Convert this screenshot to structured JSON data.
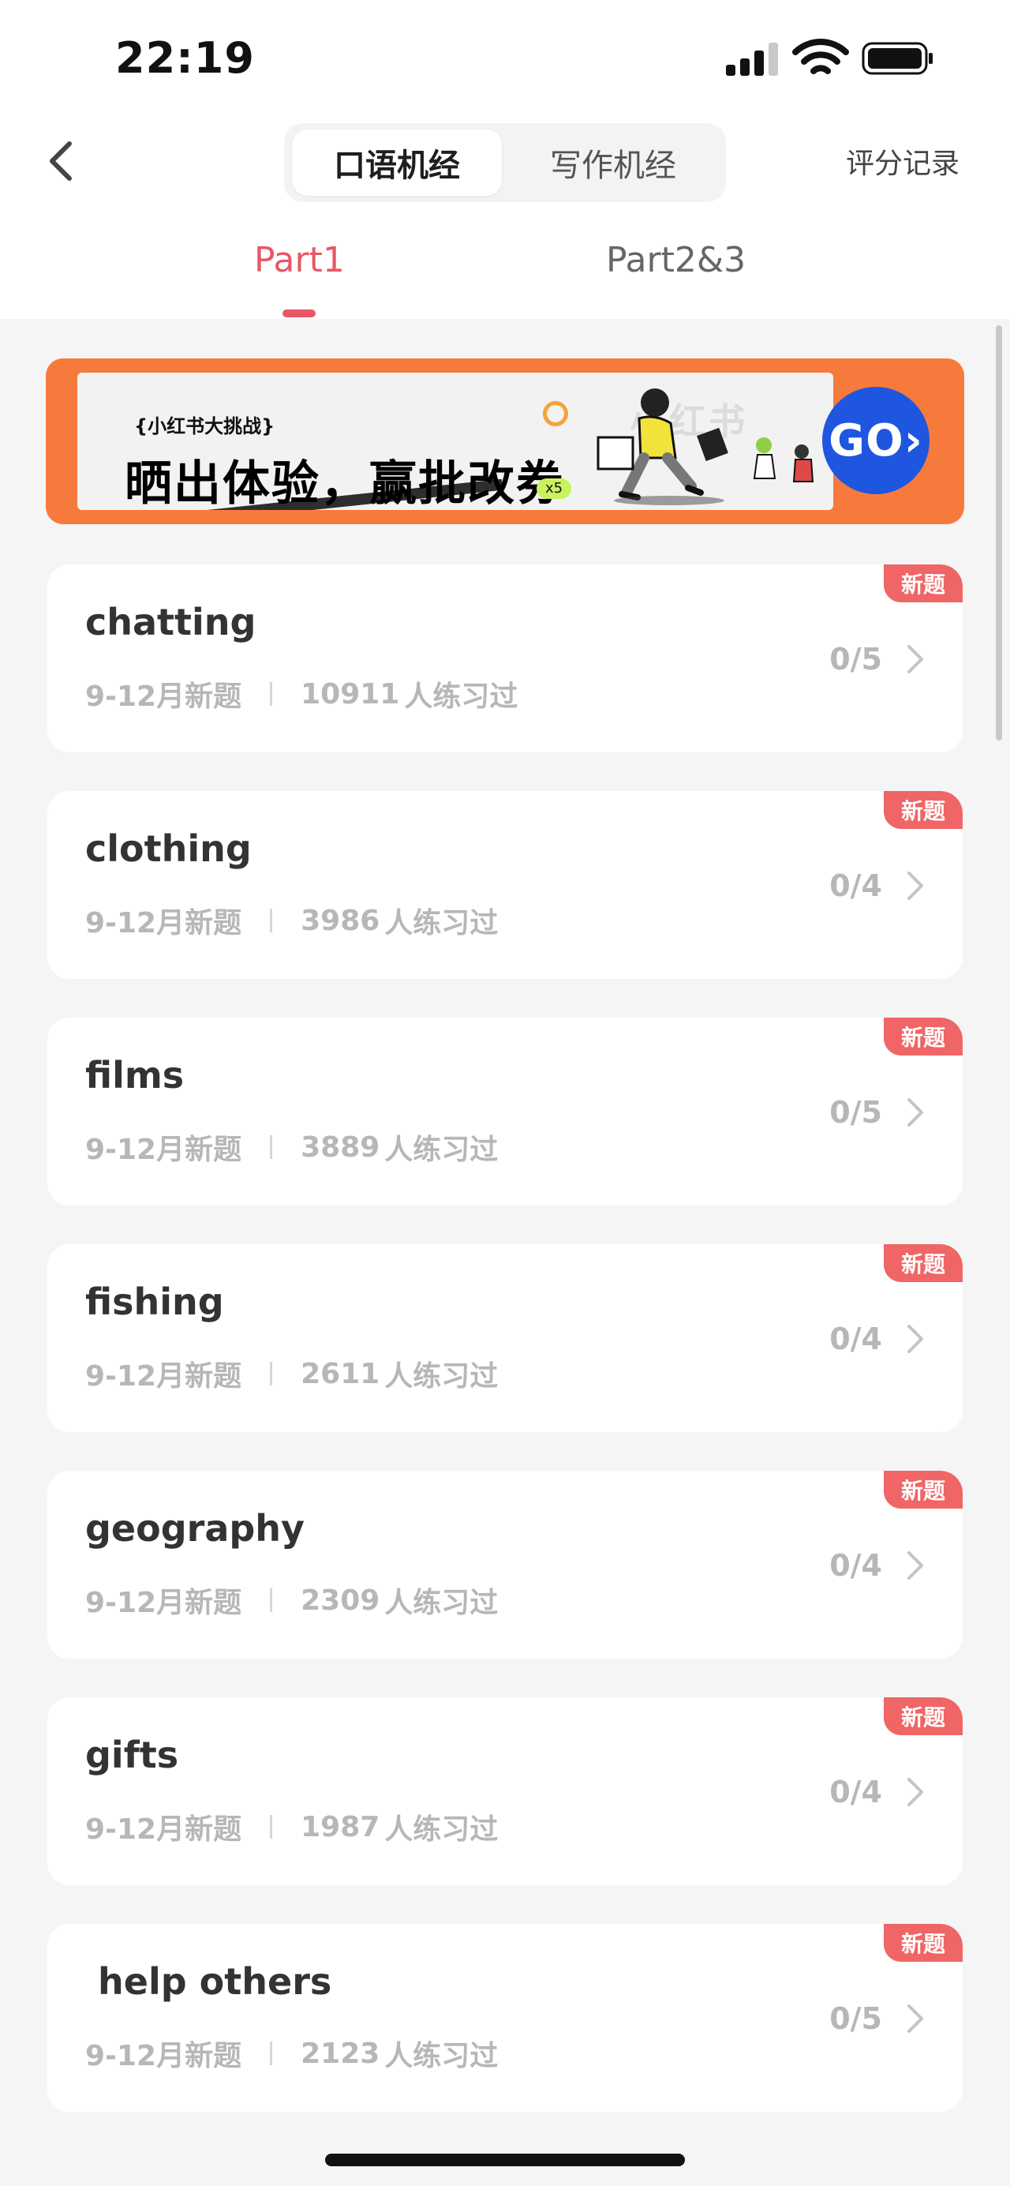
{
  "status_bar": {
    "time": "22:19"
  },
  "nav": {
    "segments": [
      "口语机经",
      "写作机经"
    ],
    "score_record": "评分记录"
  },
  "part_tabs": [
    "Part1",
    "Part2&3"
  ],
  "banner": {
    "tag": "{小红书大挑战}",
    "title": "晒出体验，赢批改券",
    "multiplier": "x5",
    "watermark": "小红书",
    "go": "GO›"
  },
  "topics": [
    {
      "title": "chatting",
      "period": "9-12月新题",
      "count": "10911",
      "practiced": "人练习过",
      "progress": "0/5",
      "badge": "新题"
    },
    {
      "title": "clothing",
      "period": "9-12月新题",
      "count": "3986",
      "practiced": "人练习过",
      "progress": "0/4",
      "badge": "新题"
    },
    {
      "title": "films",
      "period": "9-12月新题",
      "count": "3889",
      "practiced": "人练习过",
      "progress": "0/5",
      "badge": "新题"
    },
    {
      "title": "fishing",
      "period": "9-12月新题",
      "count": "2611",
      "practiced": "人练习过",
      "progress": "0/4",
      "badge": "新题"
    },
    {
      "title": "geography",
      "period": "9-12月新题",
      "count": "2309",
      "practiced": "人练习过",
      "progress": "0/4",
      "badge": "新题"
    },
    {
      "title": "gifts",
      "period": "9-12月新题",
      "count": "1987",
      "practiced": "人练习过",
      "progress": "0/4",
      "badge": "新题"
    },
    {
      "title": " help others",
      "period": "9-12月新题",
      "count": "2123",
      "practiced": "人练习过",
      "progress": "0/5",
      "badge": "新题"
    }
  ],
  "colors": {
    "accent": "#e85766",
    "badge": "#f06565",
    "banner_bg": "#f77a3d",
    "go_button": "#1f56e0"
  }
}
